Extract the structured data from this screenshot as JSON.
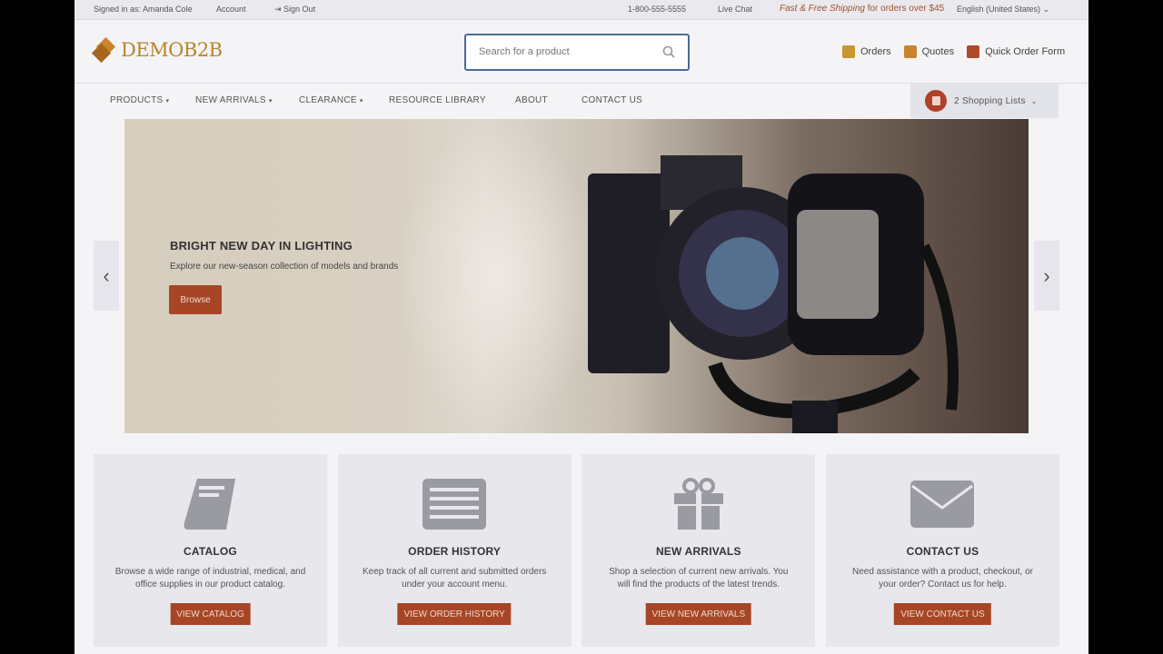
{
  "topbar": {
    "signed_in": "Signed in as: Amanda Cole",
    "account": "Account",
    "sign_out": "Sign Out",
    "phone": "1-800-555-5555",
    "live_chat": "Live Chat",
    "shipping_a": "Fast & Free Shipping",
    "shipping_b": " for orders over $45",
    "language": "English (United States)"
  },
  "header": {
    "logo": "DEMOB2B",
    "search_placeholder": "Search for a product",
    "links": [
      "Orders",
      "Quotes",
      "Quick Order Form"
    ]
  },
  "nav": {
    "items": [
      "PRODUCTS",
      "NEW ARRIVALS",
      "CLEARANCE",
      "RESOURCE LIBRARY",
      "ABOUT",
      "CONTACT US"
    ],
    "lists": "2 Shopping Lists"
  },
  "hero": {
    "title": "BRIGHT NEW DAY IN LIGHTING",
    "subtitle": "Explore our new-season collection of models and brands",
    "button": "Browse"
  },
  "tiles": [
    {
      "title": "CATALOG",
      "text": "Browse a wide range of industrial, medical, and office supplies in our product catalog.",
      "button": "VIEW CATALOG"
    },
    {
      "title": "ORDER HISTORY",
      "text": "Keep track of all current and submitted orders under your account menu.",
      "button": "VIEW ORDER HISTORY"
    },
    {
      "title": "NEW ARRIVALS",
      "text": "Shop a selection of current new arrivals. You will find the products of the latest trends.",
      "button": "VIEW NEW ARRIVALS"
    },
    {
      "title": "CONTACT US",
      "text": "Need assistance with a product, checkout, or your order? Contact us for help.",
      "button": "VIEW CONTACT US"
    }
  ],
  "colors": {
    "accent": "#a64626",
    "search_border": "#4a6c97"
  }
}
